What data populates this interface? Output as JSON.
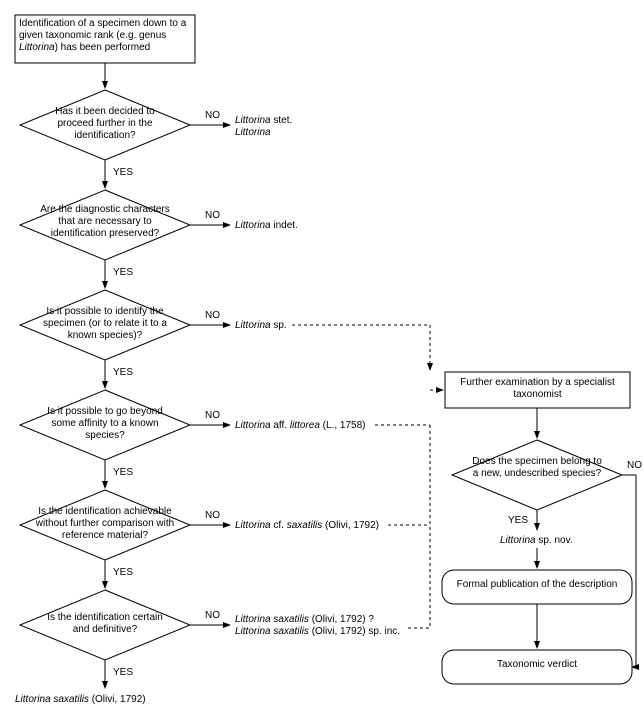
{
  "yes": "YES",
  "no": "NO",
  "start": "Identification of a specimen down to a given taxonomic rank (e.g. genus Littorina) has been performed",
  "d1": "Has it been decided to proceed further in the identification?",
  "d2": "Are the diagnostic characters that are necessary to identification preserved?",
  "d3": "Is it possible to identify the specimen (or to relate it to a known species)?",
  "d4": "Is it possible to go beyond some affinity to a known species?",
  "d5": "Is the identification achievable without further comparison with reference material?",
  "d6": "Is the identification certain and definitive?",
  "r1a": "Littorina stet.",
  "r1b": "Littorina",
  "r2": "Littorina indet.",
  "r3": "Littorina sp.",
  "r4": "Littorina aff. littorea (L., 1758)",
  "r5": "Littorina cf. saxatilis (Olivi, 1792)",
  "r6a": "Littorina saxatilis (Olivi, 1792) ?",
  "r6b": "Littorina saxatilis (Olivi, 1792) sp. inc.",
  "final": "Littorina saxatilis (Olivi, 1792)",
  "box_exam": "Further examination by a specialist taxonomist",
  "d_new": "Does the specimen belong to a new, undescribed species?",
  "spnov": "Littorina sp. nov.",
  "box_pub": "Formal publication of the description",
  "box_verdict": "Taxonomic verdict"
}
